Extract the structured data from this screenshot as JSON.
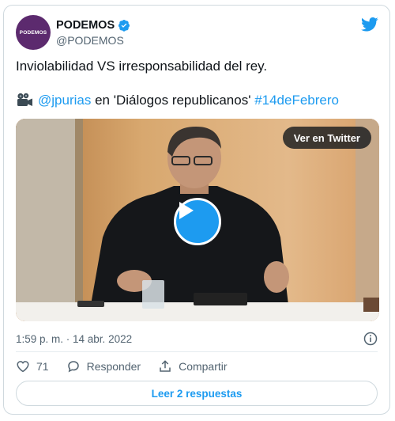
{
  "account": {
    "avatar_text": "PODEMOS",
    "name": "PODEMOS",
    "handle": "@PODEMOS",
    "verified": true
  },
  "tweet": {
    "text_line1": "Inviolabilidad VS irresponsabilidad del rey.",
    "mention": "@jpurias",
    "middle_text": " en 'Diálogos republicanos' ",
    "hashtag": "#14deFebrero"
  },
  "media": {
    "view_on_twitter_label": "Ver en Twitter"
  },
  "meta": {
    "timestamp": "1:59 p. m. · 14 abr. 2022"
  },
  "actions": {
    "likes_count": "71",
    "reply_label": "Responder",
    "share_label": "Compartir"
  },
  "footer": {
    "read_replies_label": "Leer 2 respuestas"
  },
  "colors": {
    "twitter_blue": "#1d9bf0",
    "brand_purple": "#5c2a6e",
    "text_secondary": "#536471"
  }
}
